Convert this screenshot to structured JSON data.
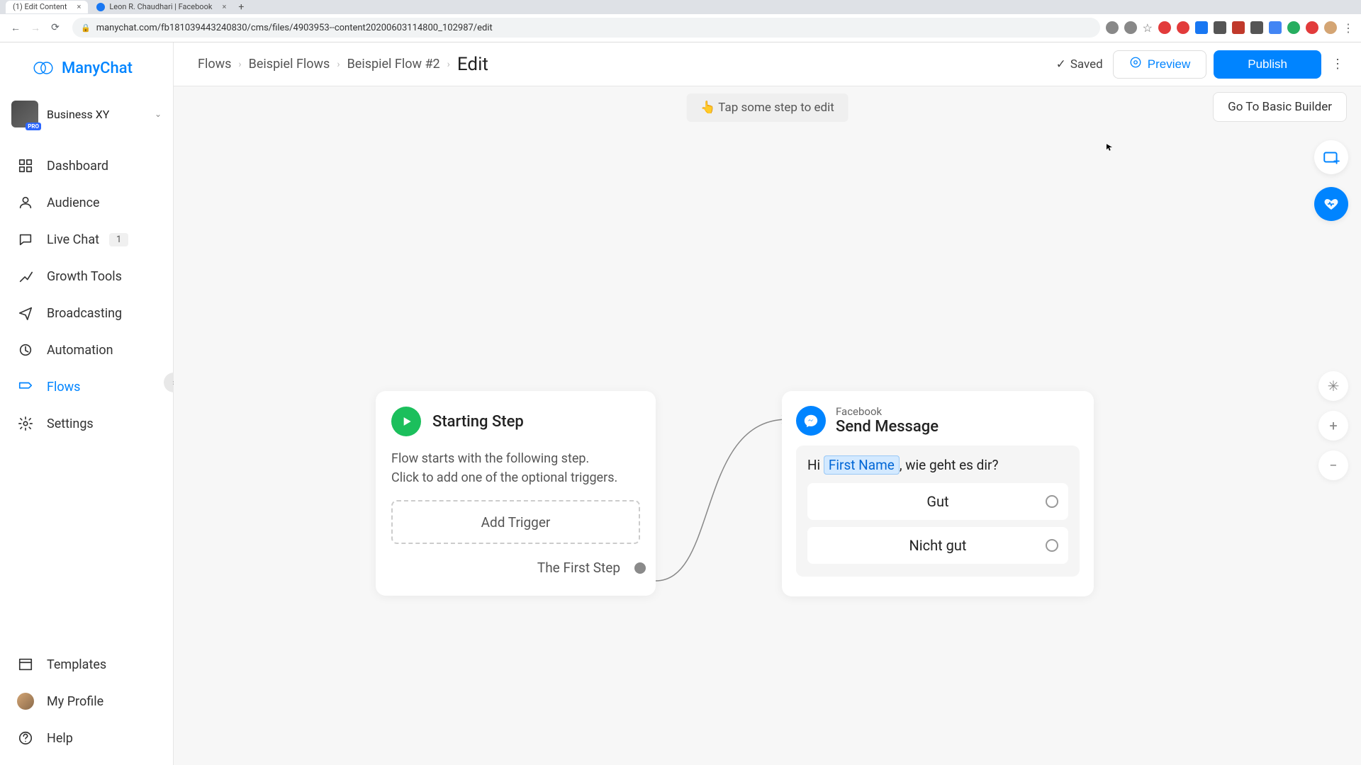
{
  "browser": {
    "tabs": [
      {
        "title": "(1) Edit Content",
        "active": true
      },
      {
        "title": "Leon R. Chaudhari | Facebook",
        "active": false
      }
    ],
    "url": "manychat.com/fb181039443240830/cms/files/4903953--content20200603114800_102987/edit"
  },
  "brand": "ManyChat",
  "workspace": {
    "name": "Business XY",
    "badge": "PRO"
  },
  "nav": {
    "items": [
      {
        "key": "dashboard",
        "label": "Dashboard"
      },
      {
        "key": "audience",
        "label": "Audience"
      },
      {
        "key": "livechat",
        "label": "Live Chat",
        "badge": "1"
      },
      {
        "key": "growth",
        "label": "Growth Tools"
      },
      {
        "key": "broadcasting",
        "label": "Broadcasting"
      },
      {
        "key": "automation",
        "label": "Automation"
      },
      {
        "key": "flows",
        "label": "Flows"
      },
      {
        "key": "settings",
        "label": "Settings"
      }
    ],
    "bottom": [
      {
        "key": "templates",
        "label": "Templates"
      },
      {
        "key": "myprofile",
        "label": "My Profile"
      },
      {
        "key": "help",
        "label": "Help"
      }
    ]
  },
  "breadcrumbs": [
    "Flows",
    "Beispiel Flows",
    "Beispiel Flow #2",
    "Edit"
  ],
  "topbar": {
    "saved": "Saved",
    "preview": "Preview",
    "publish": "Publish",
    "basic_builder": "Go To Basic Builder"
  },
  "canvas": {
    "hint": "👆 Tap some step to edit",
    "start_node": {
      "title": "Starting Step",
      "desc_line1": "Flow starts with the following step.",
      "desc_line2": "Click to add one of the optional triggers.",
      "add_trigger": "Add Trigger",
      "first_step": "The First Step"
    },
    "message_node": {
      "platform": "Facebook",
      "title": "Send Message",
      "text_pre": "Hi ",
      "variable": "First Name",
      "text_post": ", wie geht es dir?",
      "replies": [
        "Gut",
        "Nicht gut"
      ]
    }
  },
  "colors": {
    "primary": "#0084ff",
    "success": "#1bbf5c"
  }
}
